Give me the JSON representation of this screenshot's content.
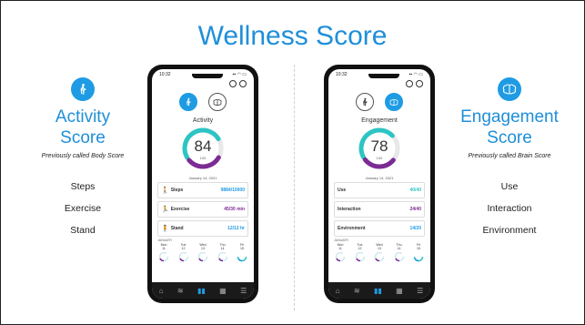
{
  "title": "Wellness Score",
  "left": {
    "score_title_1": "Activity",
    "score_title_2": "Score",
    "subtitle": "Previously called Body Score",
    "items": [
      "Steps",
      "Exercise",
      "Stand"
    ]
  },
  "right": {
    "score_title_1": "Engagement",
    "score_title_2": "Score",
    "subtitle": "Previously called Brain Score",
    "items": [
      "Use",
      "Interaction",
      "Environment"
    ]
  },
  "phone1": {
    "screen_name": "Activity",
    "score": "84",
    "max": "100",
    "score_fraction": 0.84,
    "date": "January 14, 2021",
    "rows": [
      {
        "label": "Steps",
        "value": "9884/10000"
      },
      {
        "label": "Exercise",
        "value": "45/30 min"
      },
      {
        "label": "Stand",
        "value": "12/12 hr"
      }
    ],
    "days": [
      {
        "name": "Mon",
        "num": "11"
      },
      {
        "name": "Tue",
        "num": "12"
      },
      {
        "name": "Wed",
        "num": "13"
      },
      {
        "name": "Thu",
        "num": "14"
      },
      {
        "name": "Fri",
        "num": "15"
      }
    ],
    "colors": {
      "primary": "#2ec4c4",
      "secondary": "#7b2b94",
      "accent": "#1e9be3"
    }
  },
  "phone2": {
    "screen_name": "Engagement",
    "score": "78",
    "max": "100",
    "score_fraction": 0.78,
    "date": "January 14, 2021",
    "rows": [
      {
        "label": "Use",
        "value": "40/40"
      },
      {
        "label": "Interaction",
        "value": "24/40"
      },
      {
        "label": "Environment",
        "value": "14/20"
      }
    ],
    "days": [
      {
        "name": "Mon",
        "num": "11"
      },
      {
        "name": "Tue",
        "num": "12"
      },
      {
        "name": "Wed",
        "num": "13"
      },
      {
        "name": "Thu",
        "num": "14"
      },
      {
        "name": "Fri",
        "num": "15"
      }
    ],
    "colors": {
      "primary": "#2ec4c4",
      "secondary": "#7b2b94",
      "accent": "#1e9be3"
    }
  },
  "status_time": "10:32",
  "history_label": "JANUARY"
}
